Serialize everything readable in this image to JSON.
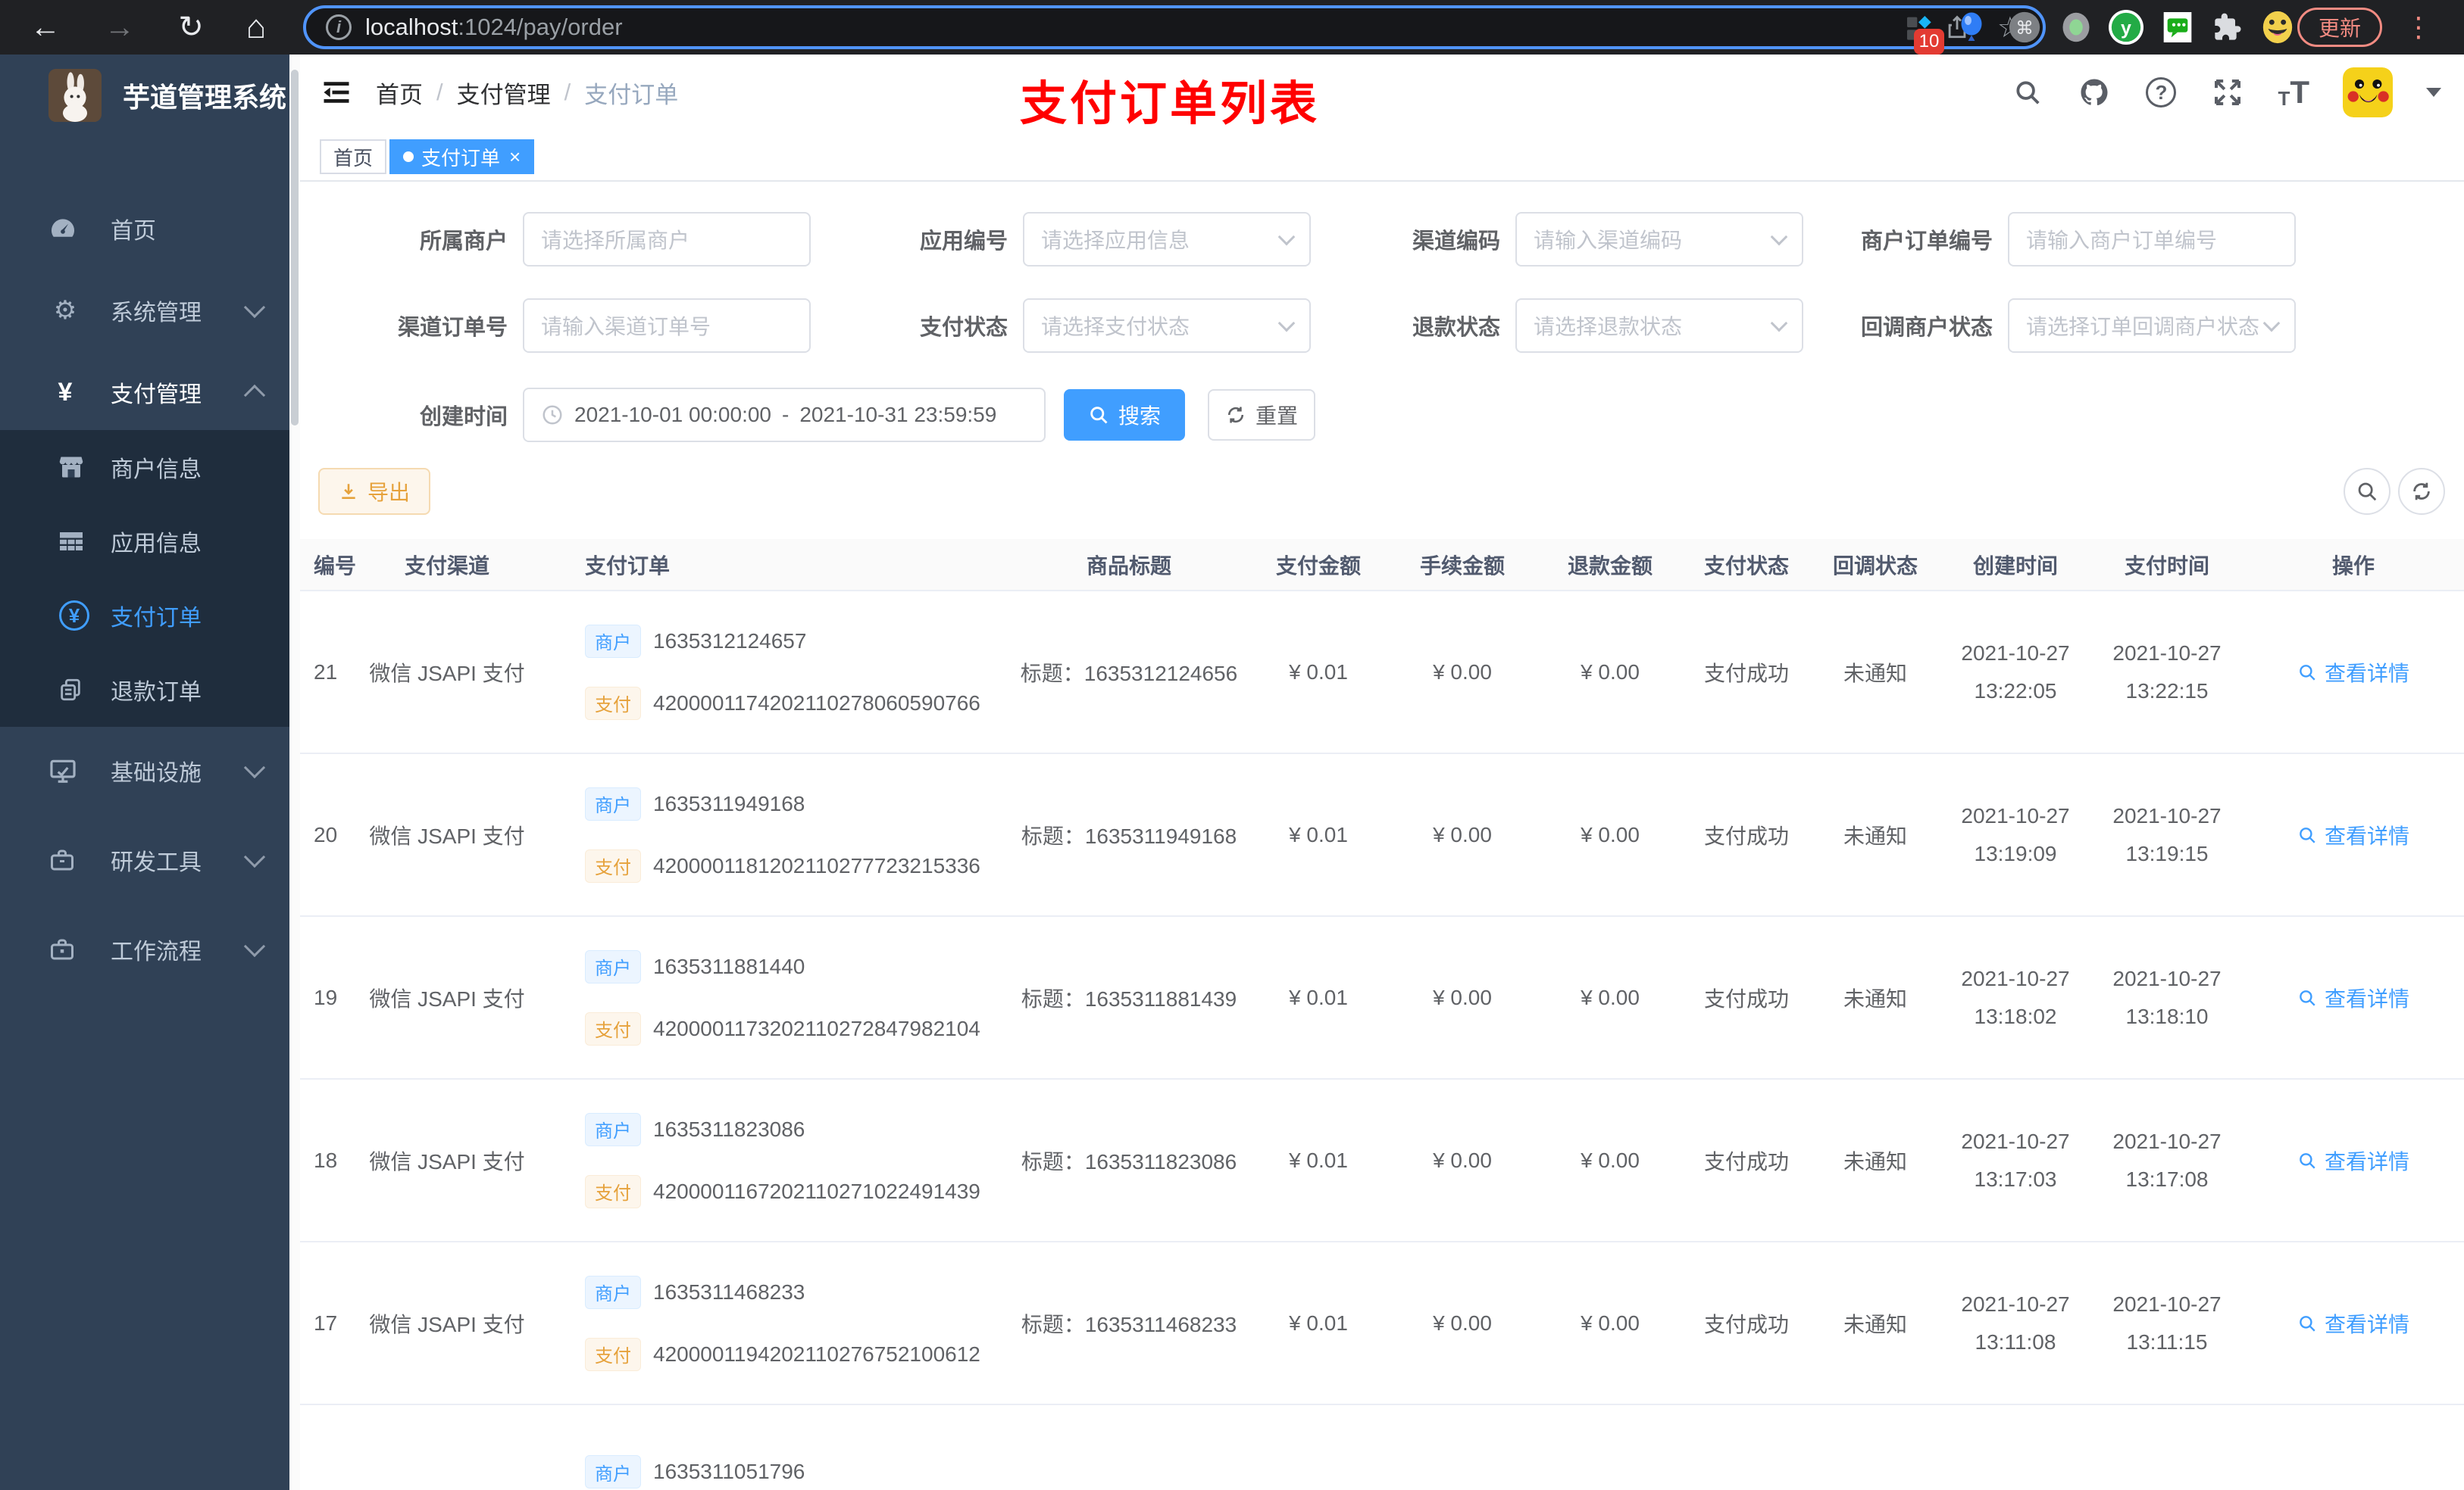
{
  "browser": {
    "url_host": "localhost",
    "url_rest": ":1024/pay/order",
    "update_label": "更新",
    "extension_badge": "10"
  },
  "sidebar": {
    "title": "芋道管理系统",
    "menu": [
      {
        "label": "首页"
      },
      {
        "label": "系统管理"
      },
      {
        "label": "支付管理"
      },
      {
        "label": "基础设施"
      },
      {
        "label": "研发工具"
      },
      {
        "label": "工作流程"
      }
    ],
    "submenu": [
      {
        "label": "商户信息"
      },
      {
        "label": "应用信息"
      },
      {
        "label": "支付订单"
      },
      {
        "label": "退款订单"
      }
    ]
  },
  "header": {
    "breadcrumb": [
      "首页",
      "支付管理",
      "支付订单"
    ],
    "separator": "/",
    "annotation": "支付订单列表"
  },
  "tabs": {
    "home": "首页",
    "current": "支付订单",
    "close": "×"
  },
  "filters": {
    "fields": [
      {
        "label": "所属商户",
        "placeholder": "请选择所属商户"
      },
      {
        "label": "应用编号",
        "placeholder": "请选择应用信息"
      },
      {
        "label": "渠道编码",
        "placeholder": "请输入渠道编码"
      },
      {
        "label": "商户订单编号",
        "placeholder": "请输入商户订单编号"
      },
      {
        "label": "渠道订单号",
        "placeholder": "请输入渠道订单号"
      },
      {
        "label": "支付状态",
        "placeholder": "请选择支付状态"
      },
      {
        "label": "退款状态",
        "placeholder": "请选择退款状态"
      },
      {
        "label": "回调商户状态",
        "placeholder": "请选择订单回调商户状态"
      }
    ],
    "date_label": "创建时间",
    "date_start": "2021-10-01 00:00:00",
    "date_separator": "-",
    "date_end": "2021-10-31 23:59:59",
    "search_label": "搜索",
    "reset_label": "重置",
    "export_label": "导出"
  },
  "table": {
    "columns": [
      "编号",
      "支付渠道",
      "支付订单",
      "商品标题",
      "支付金额",
      "手续金额",
      "退款金额",
      "支付状态",
      "回调状态",
      "创建时间",
      "支付时间",
      "操作"
    ],
    "tag_merchant": "商户",
    "tag_pay": "支付",
    "action_label": "查看详情",
    "rows": [
      {
        "id": "21",
        "channel": "微信 JSAPI 支付",
        "merchant_no": "1635312124657",
        "pay_no": "4200001174202110278060590766",
        "title": "标题：1635312124656",
        "amount": "¥ 0.01",
        "fee": "¥ 0.00",
        "refund": "¥ 0.00",
        "status": "支付成功",
        "notify": "未通知",
        "created_date": "2021-10-27",
        "created_time": "13:22:05",
        "paid_date": "2021-10-27",
        "paid_time": "13:22:15"
      },
      {
        "id": "20",
        "channel": "微信 JSAPI 支付",
        "merchant_no": "1635311949168",
        "pay_no": "4200001181202110277723215336",
        "title": "标题：1635311949168",
        "amount": "¥ 0.01",
        "fee": "¥ 0.00",
        "refund": "¥ 0.00",
        "status": "支付成功",
        "notify": "未通知",
        "created_date": "2021-10-27",
        "created_time": "13:19:09",
        "paid_date": "2021-10-27",
        "paid_time": "13:19:15"
      },
      {
        "id": "19",
        "channel": "微信 JSAPI 支付",
        "merchant_no": "1635311881440",
        "pay_no": "4200001173202110272847982104",
        "title": "标题：1635311881439",
        "amount": "¥ 0.01",
        "fee": "¥ 0.00",
        "refund": "¥ 0.00",
        "status": "支付成功",
        "notify": "未通知",
        "created_date": "2021-10-27",
        "created_time": "13:18:02",
        "paid_date": "2021-10-27",
        "paid_time": "13:18:10"
      },
      {
        "id": "18",
        "channel": "微信 JSAPI 支付",
        "merchant_no": "1635311823086",
        "pay_no": "4200001167202110271022491439",
        "title": "标题：1635311823086",
        "amount": "¥ 0.01",
        "fee": "¥ 0.00",
        "refund": "¥ 0.00",
        "status": "支付成功",
        "notify": "未通知",
        "created_date": "2021-10-27",
        "created_time": "13:17:03",
        "paid_date": "2021-10-27",
        "paid_time": "13:17:08"
      },
      {
        "id": "17",
        "channel": "微信 JSAPI 支付",
        "merchant_no": "1635311468233",
        "pay_no": "4200001194202110276752100612",
        "title": "标题：1635311468233",
        "amount": "¥ 0.01",
        "fee": "¥ 0.00",
        "refund": "¥ 0.00",
        "status": "支付成功",
        "notify": "未通知",
        "created_date": "2021-10-27",
        "created_time": "13:11:08",
        "paid_date": "2021-10-27",
        "paid_time": "13:11:15"
      }
    ],
    "partial_row": {
      "merchant_no": "1635311051796"
    }
  },
  "colors": {
    "primary": "#409eff",
    "warning": "#e6a23c",
    "annotation_red": "#ff0000",
    "sidebar_bg": "#304156",
    "submenu_bg": "#1f2d3d",
    "active_tab_bg": "#409eff"
  }
}
